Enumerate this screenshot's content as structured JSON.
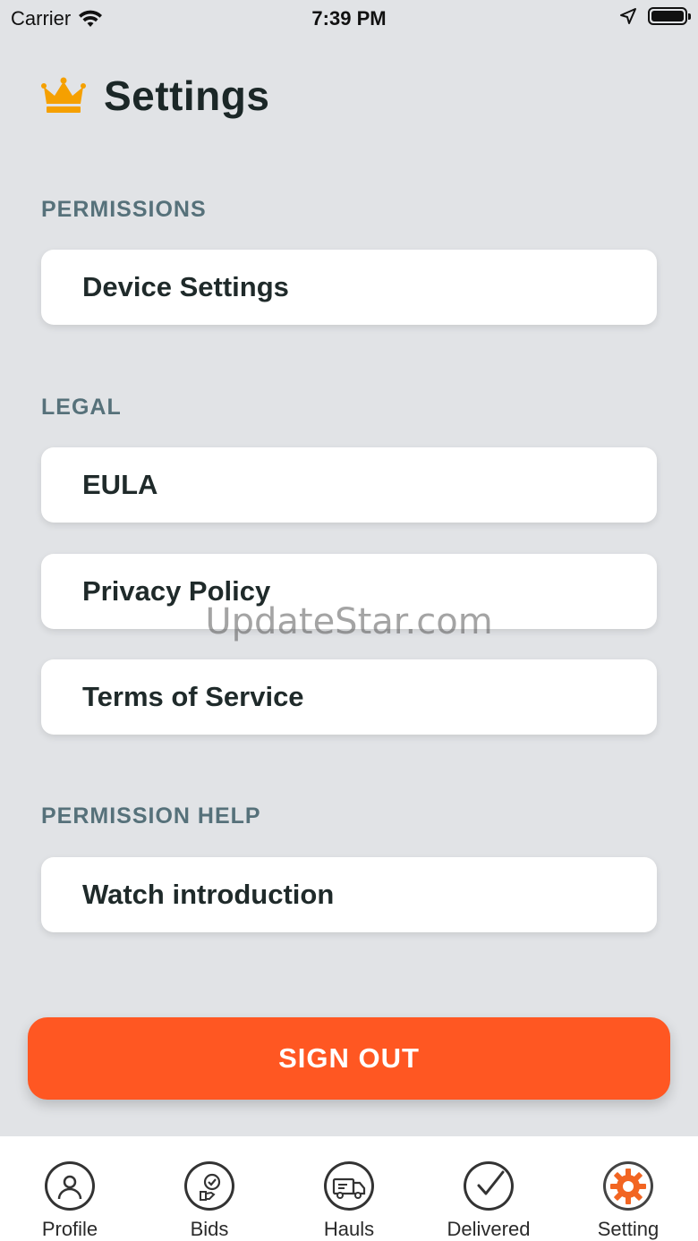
{
  "status_bar": {
    "carrier": "Carrier",
    "time": "7:39 PM"
  },
  "header": {
    "title": "Settings",
    "icon": "crown-icon",
    "icon_color": "#f5a000"
  },
  "sections": [
    {
      "label": "PERMISSIONS",
      "items": [
        {
          "label": "Device Settings"
        }
      ]
    },
    {
      "label": "LEGAL",
      "items": [
        {
          "label": "EULA"
        },
        {
          "label": "Privacy Policy"
        },
        {
          "label": "Terms of Service"
        }
      ]
    },
    {
      "label": "PERMISSION HELP",
      "items": [
        {
          "label": "Watch introduction"
        }
      ]
    }
  ],
  "watermark": "UpdateStar.com",
  "sign_out": {
    "label": "SIGN OUT",
    "color": "#ff5722"
  },
  "tabs": [
    {
      "label": "Profile",
      "icon": "user-icon"
    },
    {
      "label": "Bids",
      "icon": "bids-icon"
    },
    {
      "label": "Hauls",
      "icon": "truck-icon"
    },
    {
      "label": "Delivered",
      "icon": "check-icon"
    },
    {
      "label": "Setting",
      "icon": "gear-icon",
      "active": true
    }
  ],
  "colors": {
    "background": "#e1e3e6",
    "accent": "#ff5722",
    "active_tab_icon": "#f26522"
  }
}
